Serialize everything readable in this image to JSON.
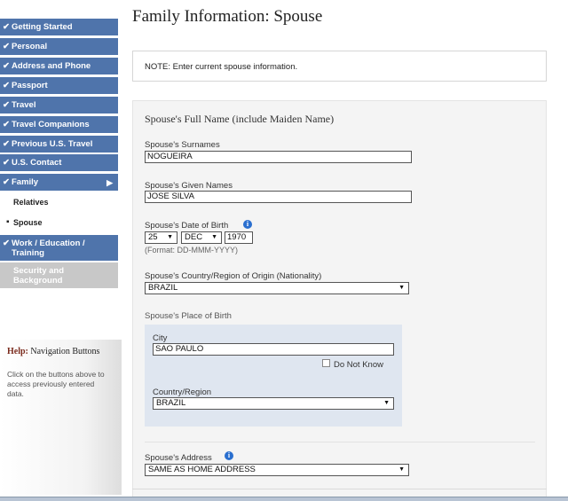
{
  "sidebar": {
    "items": [
      {
        "label": "Getting Started",
        "check": "✔"
      },
      {
        "label": "Personal",
        "check": "✔"
      },
      {
        "label": "Address and Phone",
        "check": "✔"
      },
      {
        "label": "Passport",
        "check": "✔"
      },
      {
        "label": "Travel",
        "check": "✔"
      },
      {
        "label": "Travel Companions",
        "check": "✔"
      },
      {
        "label": "Previous U.S. Travel",
        "check": "✔"
      },
      {
        "label": "U.S. Contact",
        "check": "✔"
      },
      {
        "label": "Family",
        "check": "✔",
        "arrow": "▶"
      }
    ],
    "sub_items": [
      {
        "label": "Relatives"
      },
      {
        "label": "Spouse",
        "bullet": "▪"
      }
    ],
    "work": {
      "label_line1": "Work / Education /",
      "label_line2": "Training",
      "check": "✔"
    },
    "security": {
      "label_line1": "Security and",
      "label_line2": "Background"
    },
    "help": {
      "title_bold": "Help:",
      "title_rest": "Navigation Buttons",
      "text": "Click on the buttons above to access previously entered data."
    }
  },
  "main": {
    "title": "Family Information: Spouse",
    "note": "NOTE: Enter current spouse information.",
    "section_title": "Spouse's Full Name (include Maiden Name)",
    "surnames": {
      "label": "Spouse's Surnames",
      "value": "NOGUEIRA"
    },
    "given_names": {
      "label": "Spouse's Given Names",
      "value": "JOSE SILVA"
    },
    "dob": {
      "label": "Spouse's Date of Birth",
      "day": "25",
      "month": "DEC",
      "year": "1970",
      "format_hint": "(Format: DD-MMM-YYYY)"
    },
    "nationality": {
      "label": "Spouse's Country/Region of Origin (Nationality)",
      "value": "BRAZIL"
    },
    "place_of_birth": {
      "label": "Spouse's Place of Birth",
      "city_label": "City",
      "city_value": "SAO PAULO",
      "do_not_know": "Do Not Know",
      "country_label": "Country/Region",
      "country_value": "BRAZIL"
    },
    "address": {
      "label": "Spouse's Address",
      "value": "SAME AS HOME ADDRESS"
    }
  },
  "icons": {
    "info": "i",
    "dropdown": "▼"
  },
  "colors": {
    "nav_bg": "#4f74ab",
    "disabled_bg": "#c8c8c8",
    "info_icon": "#2a6fcf",
    "pob_bg": "#dfe6f0"
  }
}
